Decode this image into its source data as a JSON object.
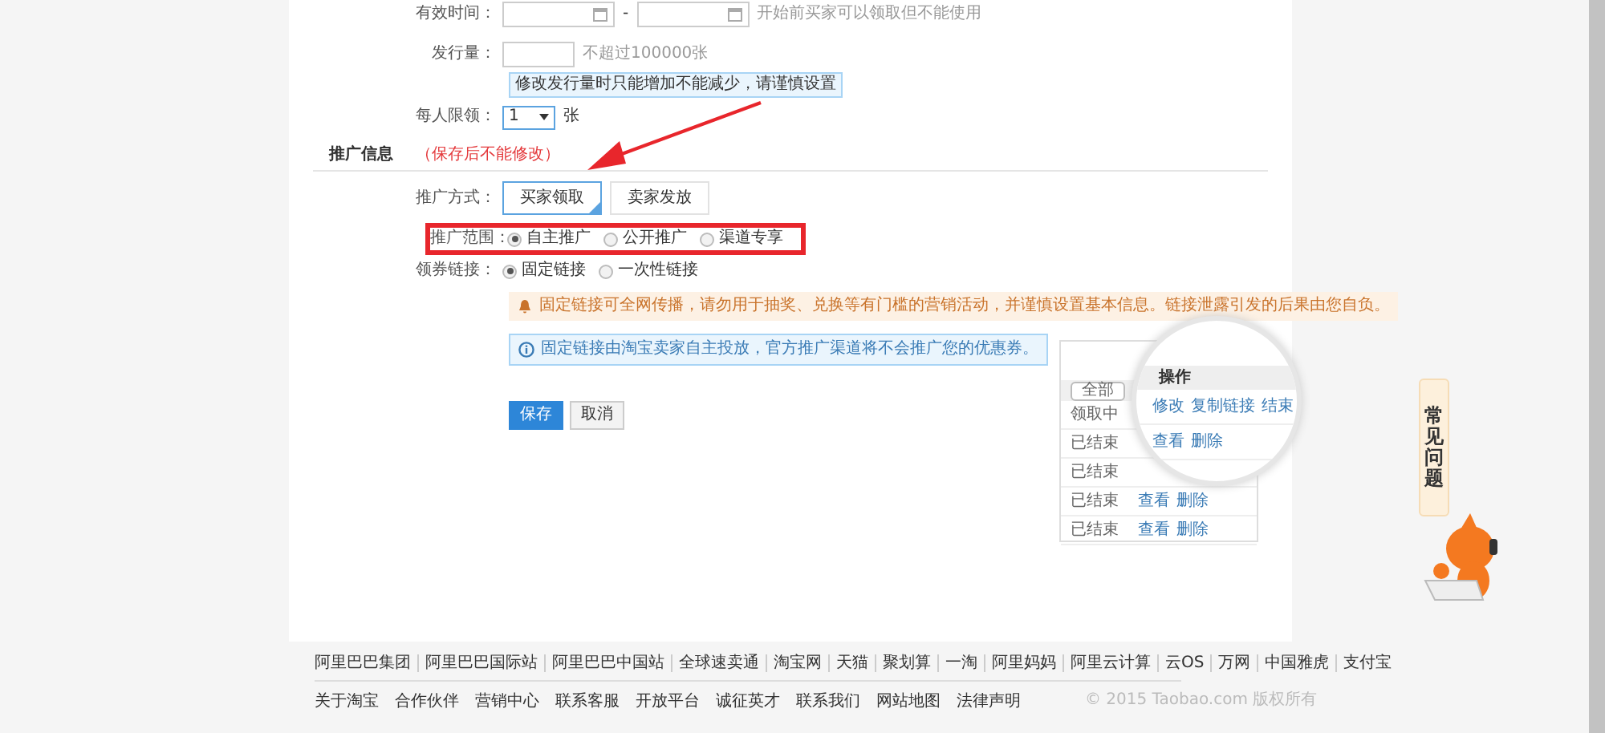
{
  "validity": {
    "label": "有效时间：",
    "separator": "-",
    "hint": "开始前买家可以领取但不能使用"
  },
  "quantity": {
    "label": "发行量：",
    "hint": "不超过100000张",
    "tip": "修改发行量时只能增加不能减少，请谨慎设置"
  },
  "per_person_limit": {
    "label": "每人限领：",
    "value": "1",
    "unit": "张"
  },
  "promotion_section": {
    "title": "推广信息",
    "note": "（保存后不能修改）"
  },
  "promotion_method": {
    "label": "推广方式：",
    "options": [
      {
        "label": "买家领取",
        "selected": true
      },
      {
        "label": "卖家发放",
        "selected": false
      }
    ]
  },
  "promotion_scope": {
    "label": "推广范围：",
    "highlighted": true,
    "options": [
      {
        "label": "自主推广",
        "selected": true
      },
      {
        "label": "公开推广",
        "selected": false
      },
      {
        "label": "渠道专享",
        "selected": false
      }
    ]
  },
  "coupon_link": {
    "label": "领券链接：",
    "options": [
      {
        "label": "固定链接",
        "selected": true
      },
      {
        "label": "一次性链接",
        "selected": false
      }
    ]
  },
  "notices": [
    {
      "kind": "warning",
      "text": "固定链接可全网传播，请勿用于抽奖、兑换等有门槛的营销活动，并谨慎设置基本信息。链接泄露引发的后果由您自负。"
    },
    {
      "kind": "info",
      "text": "固定链接由淘宝卖家自主投放，官方推广渠道将不会推广您的优惠券。"
    }
  ],
  "buttons": [
    {
      "kind": "primary",
      "label": "保存"
    },
    {
      "kind": "default",
      "label": "取消"
    }
  ],
  "example_screenshot": {
    "filter": "全部",
    "rows": [
      {
        "status": "领取中",
        "actions": []
      },
      {
        "status": "已结束",
        "actions": []
      },
      {
        "status": "已结束",
        "actions": []
      },
      {
        "status": "已结束",
        "actions": [
          "查看",
          "删除"
        ]
      },
      {
        "status": "已结束",
        "actions": [
          "查看",
          "删除"
        ]
      }
    ],
    "magnifier": {
      "header": "操作",
      "rows": [
        [
          "修改",
          "复制链接",
          "结束"
        ],
        [
          "查看",
          "删除"
        ]
      ]
    }
  },
  "faq_tab": {
    "label": "常见问题"
  },
  "footer": {
    "links": [
      "阿里巴巴集团",
      "阿里巴巴国际站",
      "阿里巴巴中国站",
      "全球速卖通",
      "淘宝网",
      "天猫",
      "聚划算",
      "一淘",
      "阿里妈妈",
      "阿里云计算",
      "云OS",
      "万网",
      "中国雅虎",
      "支付宝"
    ],
    "bottom_links": [
      "关于淘宝",
      "合作伙伴",
      "营销中心",
      "联系客服",
      "开放平台",
      "诚征英才",
      "联系我们",
      "网站地图",
      "法律声明"
    ],
    "copyright": "© 2015 Taobao.com 版权所有"
  }
}
